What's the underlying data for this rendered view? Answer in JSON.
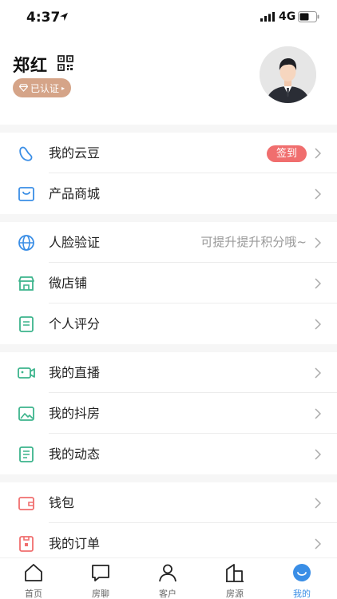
{
  "status": {
    "time": "4:37",
    "network": "4G"
  },
  "profile": {
    "name": "郑红",
    "badge": "已认证"
  },
  "menu": {
    "sign_in": "签到",
    "face_hint": "可提升提升积分哦~",
    "items": [
      {
        "label": "我的云豆"
      },
      {
        "label": "产品商城"
      },
      {
        "label": "人脸验证"
      },
      {
        "label": "微店铺"
      },
      {
        "label": "个人评分"
      },
      {
        "label": "我的直播"
      },
      {
        "label": "我的抖房"
      },
      {
        "label": "我的动态"
      },
      {
        "label": "钱包"
      },
      {
        "label": "我的订单"
      }
    ]
  },
  "tabs": [
    {
      "label": "首页"
    },
    {
      "label": "房聊"
    },
    {
      "label": "客户"
    },
    {
      "label": "房源"
    },
    {
      "label": "我的"
    }
  ],
  "colors": {
    "accent": "#3a8ee6",
    "green": "#3cb48c",
    "red": "#f06e6e",
    "badge": "#d5a488"
  }
}
